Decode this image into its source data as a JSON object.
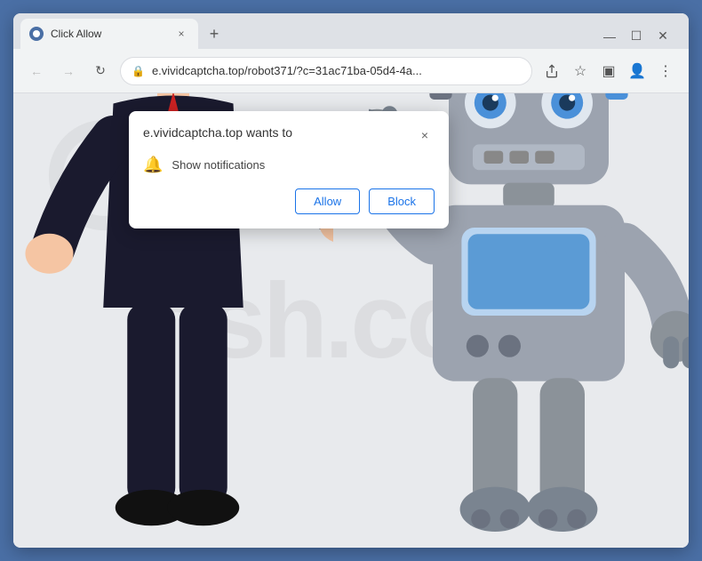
{
  "browser": {
    "tab": {
      "title": "Click Allow",
      "favicon_label": "globe-favicon"
    },
    "window_controls": {
      "minimize": "—",
      "maximize": "☐",
      "close": "✕",
      "chevron": "⌄"
    },
    "nav": {
      "back": "←",
      "forward": "→",
      "refresh": "↻"
    },
    "address_bar": {
      "url": "e.vividcaptcha.top/robot371/?c=31ac71ba-05d4-4a...",
      "lock_icon": "🔒"
    },
    "toolbar": {
      "share_icon": "⎋",
      "star_icon": "☆",
      "extensions_icon": "▣",
      "account_icon": "👤",
      "menu_icon": "⋮"
    }
  },
  "popup": {
    "title": "e.vividcaptcha.top wants to",
    "close_label": "×",
    "notification_row": {
      "icon": "🔔",
      "text": "Show notifications"
    },
    "buttons": {
      "allow": "Allow",
      "block": "Block"
    }
  },
  "watermark": {
    "text": "rish.com"
  }
}
